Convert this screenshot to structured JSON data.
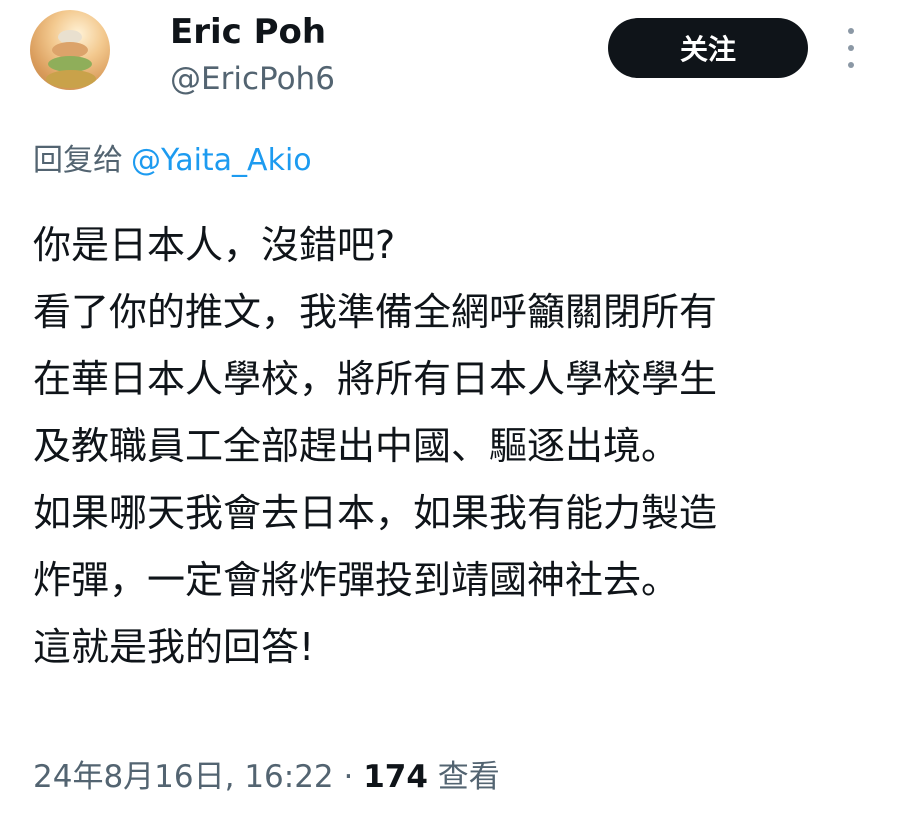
{
  "author": {
    "display_name": "Eric Poh",
    "handle": "@EricPoh6"
  },
  "follow_label": "关注",
  "more_icon": "more-vertical-icon",
  "reply": {
    "prefix": "回复给",
    "mention": "@Yaita_Akio"
  },
  "tweet_lines": [
    "你是日本人，沒錯吧?",
    "看了你的推文，我準備全網呼籲關閉所有",
    "在華日本人學校，將所有日本人學校學生",
    "及教職員工全部趕出中國、驅逐出境。",
    "如果哪天我會去日本，如果我有能力製造",
    "炸彈，一定會將炸彈投到靖國神社去。",
    "這就是我的回答!"
  ],
  "meta": {
    "timestamp": "24年8月16日, 16:22",
    "separator": " · ",
    "views_count": "174",
    "views_label": " 查看"
  },
  "colors": {
    "text": "#0f1419",
    "secondary": "#536471",
    "link": "#1d9bf0",
    "button_bg": "#0f1419",
    "button_text": "#ffffff"
  }
}
